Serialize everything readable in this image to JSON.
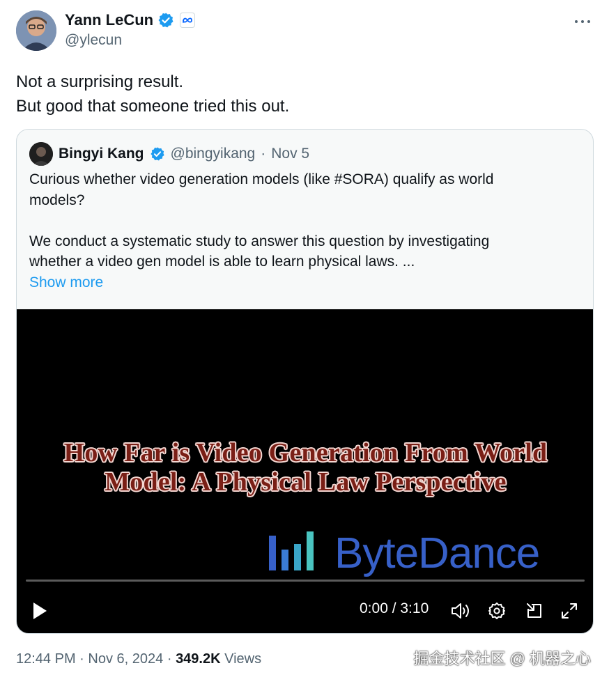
{
  "author": {
    "name": "Yann LeCun",
    "handle": "@ylecun",
    "verified_color": "#1d9bf0",
    "affiliation_icon": "meta-logo-icon"
  },
  "tweet": {
    "lines": [
      "Not a surprising result.",
      "But good that someone tried this out."
    ]
  },
  "quote": {
    "name": "Bingyi Kang",
    "handle": "@bingyikang",
    "separator": "·",
    "date": "Nov 5",
    "paragraphs": [
      [
        "Curious whether video generation models (like #SORA) qualify as world",
        "models?"
      ],
      [
        "We conduct a systematic study to answer this question by investigating",
        "whether a video gen model is able to learn physical laws. ..."
      ]
    ],
    "show_more": "Show more"
  },
  "video": {
    "title_lines": [
      "How Far is Video Generation From World",
      "Model: A Physical Law Perspective"
    ],
    "brand": "ByteDance",
    "brand_color": "#3760c8",
    "timecode": "0:00 / 3:10",
    "progress": 0
  },
  "footer": {
    "time": "12:44 PM",
    "sep1": "·",
    "date": "Nov 6, 2024",
    "sep2": "·",
    "views_count": "349.2K",
    "views_label": "Views"
  },
  "watermark": "掘金技术社区 @ 机器之心"
}
